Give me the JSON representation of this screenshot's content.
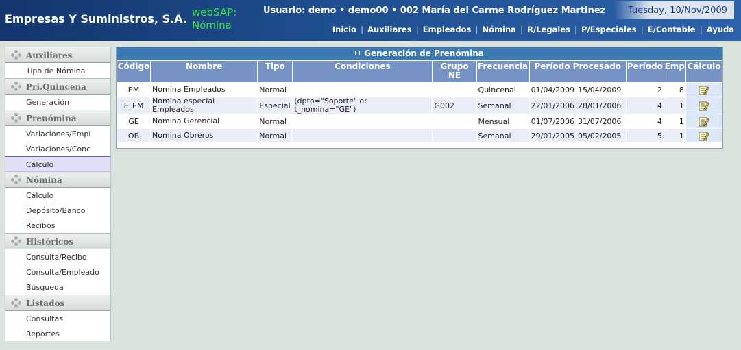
{
  "header": {
    "company": "Empresas Y Suministros, S.A.",
    "app": "webSAP: Nómina",
    "user_line": "Usuario: demo • demo00 • 002 María del Carme  Rodríguez Martinez",
    "date": "Tuesday, 10/Nov/2009",
    "nav": [
      "Inicio",
      "Auxiliares",
      "Empleados",
      "Nómina",
      "R/Legales",
      "P/Especiales",
      "E/Contable",
      "Ayuda"
    ]
  },
  "sidebar": {
    "sections": [
      {
        "title": "Auxiliares",
        "items": [
          "Tipo de Nómina"
        ]
      },
      {
        "title": "Pri.Quincena",
        "items": [
          "Generación"
        ]
      },
      {
        "title": "Prenómina",
        "items": [
          "Variaciones/Empl",
          "Variaciones/Conc",
          "Cálculo"
        ]
      },
      {
        "title": "Nómina",
        "items": [
          "Cálculo",
          "Depósito/Banco",
          "Recibos"
        ]
      },
      {
        "title": "Históricos",
        "items": [
          "Consulta/Recibo",
          "Consulta/Empleado",
          "Búsqueda"
        ]
      },
      {
        "title": "Listados",
        "items": [
          "Consultas",
          "Reportes"
        ]
      }
    ],
    "active_item": "Cálculo"
  },
  "panel": {
    "title": "Generación de Prenómina",
    "columns": [
      "Código",
      "Nombre",
      "Tipo",
      "Condiciones",
      "Grupo NE",
      "Frecuencia",
      "Período Procesado",
      "Período",
      "Emp",
      "Cálculo"
    ],
    "rows": [
      {
        "codigo": "EM",
        "nombre": "Nomina Empleados",
        "tipo": "Normal",
        "condiciones": "",
        "grupo": "",
        "frecuencia": "Quincenal",
        "desde": "01/04/2009",
        "hasta": "15/04/2009",
        "periodo": "2",
        "emp": "8"
      },
      {
        "codigo": "E_EM",
        "nombre": "Nomina especial Empleados",
        "tipo": "Especial",
        "condiciones": "(dpto=\"Soporte\" or t_nomina=\"GE\")",
        "grupo": "G002",
        "frecuencia": "Semanal",
        "desde": "22/01/2006",
        "hasta": "28/01/2006",
        "periodo": "4",
        "emp": "1"
      },
      {
        "codigo": "GE",
        "nombre": "Nomina Gerencial",
        "tipo": "Normal",
        "condiciones": "",
        "grupo": "",
        "frecuencia": "Mensual",
        "desde": "01/07/2006",
        "hasta": "31/07/2006",
        "periodo": "4",
        "emp": "1"
      },
      {
        "codigo": "OB",
        "nombre": "Nomina Obreros",
        "tipo": "Normal",
        "condiciones": "",
        "grupo": "",
        "frecuencia": "Semanal",
        "desde": "29/01/2005",
        "hasta": "05/02/2005",
        "periodo": "5",
        "emp": "1"
      }
    ],
    "action_icon": "edit-note-icon"
  },
  "colors": {
    "header_dark": "#13356d",
    "app_green": "#3ee53e",
    "panel_title": "#3d79b1",
    "table_header": "#7792c4",
    "row_alt": "#e9eefa",
    "background": "#d9e3dc"
  }
}
